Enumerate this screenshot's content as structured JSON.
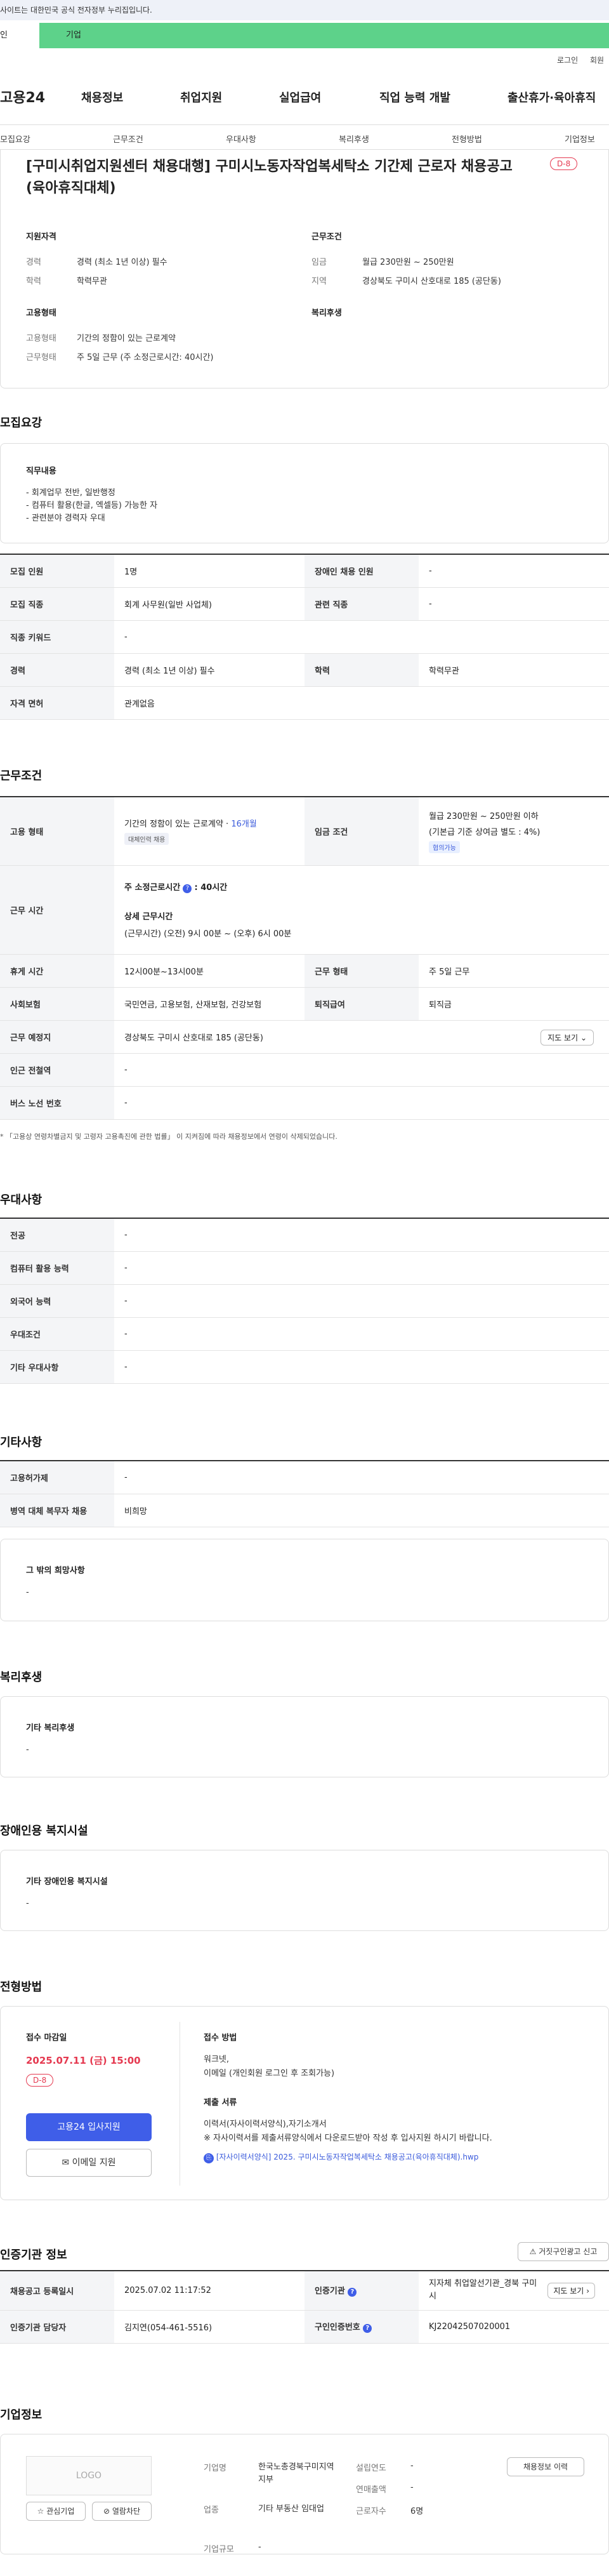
{
  "topbar": {
    "notice": "사이트는 대한민국 공식 전자정부 누리집입니다."
  },
  "scope_tabs": {
    "individual": "인",
    "company": "기업"
  },
  "util": {
    "login": "로그인",
    "join": "회원"
  },
  "gnb": {
    "logo": "고용24",
    "items": [
      "채용정보",
      "취업지원",
      "실업급여",
      "직업 능력 개발",
      "출산휴가·육아휴직"
    ]
  },
  "tabs": [
    "모집요강",
    "근무조건",
    "우대사항",
    "복리후생",
    "전형방법",
    "기업정보"
  ],
  "header": {
    "title": "[구미시취업지원센터 채용대행] 구미시노동자작업복세탁소 기간제 근로자 채용공고(육아휴직대체)",
    "dday": "D-8"
  },
  "summary": {
    "qual_title": "지원자격",
    "career_lbl": "경력",
    "career_val": "경력 (최소 1년 이상) 필수",
    "edu_lbl": "학력",
    "edu_val": "학력무관",
    "cond_title": "근무조건",
    "wage_lbl": "임금",
    "wage_val": "월급 230만원 ~ 250만원",
    "region_lbl": "지역",
    "region_val": "경상북도 구미시 산호대로 185 (공단동)",
    "emp_title": "고용형태",
    "emptype_lbl": "고용형태",
    "emptype_val": "기간의 정함이 있는 근로계약",
    "hours_lbl": "근무형태",
    "hours_val": "주 5일 근무 (주 소정근로시간: 40시간)",
    "welfare_title": "복리후생"
  },
  "recruit": {
    "title": "모집요강",
    "duty_title": "직무내용",
    "duties": [
      "- 회계업무 전반, 일반행정",
      "- 컴퓨터 활용(한글, 엑셀등) 가능한 자",
      "- 관련분야 경력자 우대"
    ],
    "rows": [
      [
        "모집 인원",
        "1명",
        "장애인 채용 인원",
        "-"
      ],
      [
        "모집 직종",
        "회계 사무원(일반 사업체)",
        "관련 직종",
        "-"
      ],
      [
        "직종 키워드",
        "-"
      ],
      [
        "경력",
        "경력 (최소 1년 이상) 필수",
        "학력",
        "학력무관"
      ],
      [
        "자격 면허",
        "관계없음"
      ]
    ]
  },
  "work": {
    "title": "근무조건",
    "emp_lbl": "고용 형태",
    "emp_val": "기간의 정함이 있는 근로계약 · ",
    "emp_months": "16개월",
    "emp_chip": "대체인력 채용",
    "wage_lbl": "임금 조건",
    "wage_val1": "월급 230만원 ~ 250만원 이하",
    "wage_val2": "(기본급 기준 상여금 별도 : 4%)",
    "wage_chip": "협의가능",
    "time_lbl": "근무 시간",
    "time_week": "주 소정근로시간",
    "time_week_val": ": 40시간",
    "time_detail_title": "상세 근무시간",
    "time_detail": "(근무시간) (오전) 9시 00분 ~ (오후) 6시 00분",
    "rows": [
      [
        "휴게 시간",
        "12시00분~13시00분",
        "근무 형태",
        "주 5일 근무"
      ],
      [
        "사회보험",
        "국민연금, 고용보험, 산재보험, 건강보험",
        "퇴직급여",
        "퇴직금"
      ]
    ],
    "place_lbl": "근무 예정지",
    "place_val": "경상북도 구미시 산호대로 185 (공단동)",
    "map_btn": "지도 보기",
    "station_lbl": "인근 전철역",
    "station_val": "-",
    "bus_lbl": "버스 노선 번호",
    "bus_val": "-",
    "footnote": "* 「고용상 연령차별금지 및 고령자 고용촉진에 관한 법률」 이 지켜짐에 따라 채용정보에서 연령이 삭제되었습니다."
  },
  "pref": {
    "title": "우대사항",
    "rows": [
      [
        "전공",
        "-"
      ],
      [
        "컴퓨터 활용 능력",
        "-"
      ],
      [
        "외국어 능력",
        "-"
      ],
      [
        "우대조건",
        "-"
      ],
      [
        "기타 우대사항",
        "-"
      ]
    ]
  },
  "etc": {
    "title": "기타사항",
    "rows": [
      [
        "고용허가제",
        "-"
      ],
      [
        "병역 대체 복무자 채용",
        "비희망"
      ]
    ],
    "other_title": "그 밖의 희망사항",
    "other_val": "-"
  },
  "welfare": {
    "title": "복리후생",
    "sub": "기타 복리후생",
    "val": "-"
  },
  "disabled": {
    "title": "장애인용 복지시설",
    "sub": "기타 장애인용 복지시설",
    "val": "-"
  },
  "apply": {
    "title": "전형방법",
    "deadline_lbl": "접수 마감일",
    "deadline": "2025.07.11 (금) 15:00",
    "dday": "D-8",
    "apply_btn": "고용24 입사지원",
    "email_btn": "이메일 지원",
    "method_lbl": "접수 방법",
    "method1": "워크넷,",
    "method2": "이메일 (개인회원 로그인 후 조회가능)",
    "docs_lbl": "제출 서류",
    "docs1": "이력서(자사이력서양식),자기소개서",
    "docs2": "※ 자사이력서를 제출서류양식에서 다운로드받아 작성 후 입사지원 하시기 바랍니다.",
    "file": "[자사이력서양식] 2025. 구미시노동자작업복세탁소 채용공고(육아휴직대체).hwp"
  },
  "cert": {
    "title": "인증기관 정보",
    "report_btn": "거짓구인광고 신고",
    "reg_lbl": "채용공고 등록일시",
    "reg_val": "2025.07.02 11:17:52",
    "org_lbl": "인증기관",
    "org_val": "지자체 취업알선기관_경북 구미시",
    "map_btn": "지도 보기",
    "mgr_lbl": "인증기관 담당자",
    "mgr_val": "김지연(054-461-5516)",
    "no_lbl": "구인인증번호",
    "no_val": "KJ22042507020001"
  },
  "company": {
    "title": "기업정보",
    "logo": "LOGO",
    "fav_btn": "관심기업",
    "block_btn": "열람차단",
    "info_btn": "채용정보 이력",
    "name_lbl": "기업명",
    "name_val": "한국노총경북구미지역지부",
    "year_lbl": "설립연도",
    "year_val": "-",
    "sales_lbl": "연매출액",
    "sales_val": "-",
    "ind_lbl": "업종",
    "ind_val": "기타 부동산 임대업",
    "emp_lbl": "근로자수",
    "emp_val": "6명",
    "size_lbl": "기업규모",
    "size_val": "-"
  },
  "colors": {
    "accent": "#3f5ee8",
    "green": "#5dd28a",
    "dday": "#e53950"
  }
}
